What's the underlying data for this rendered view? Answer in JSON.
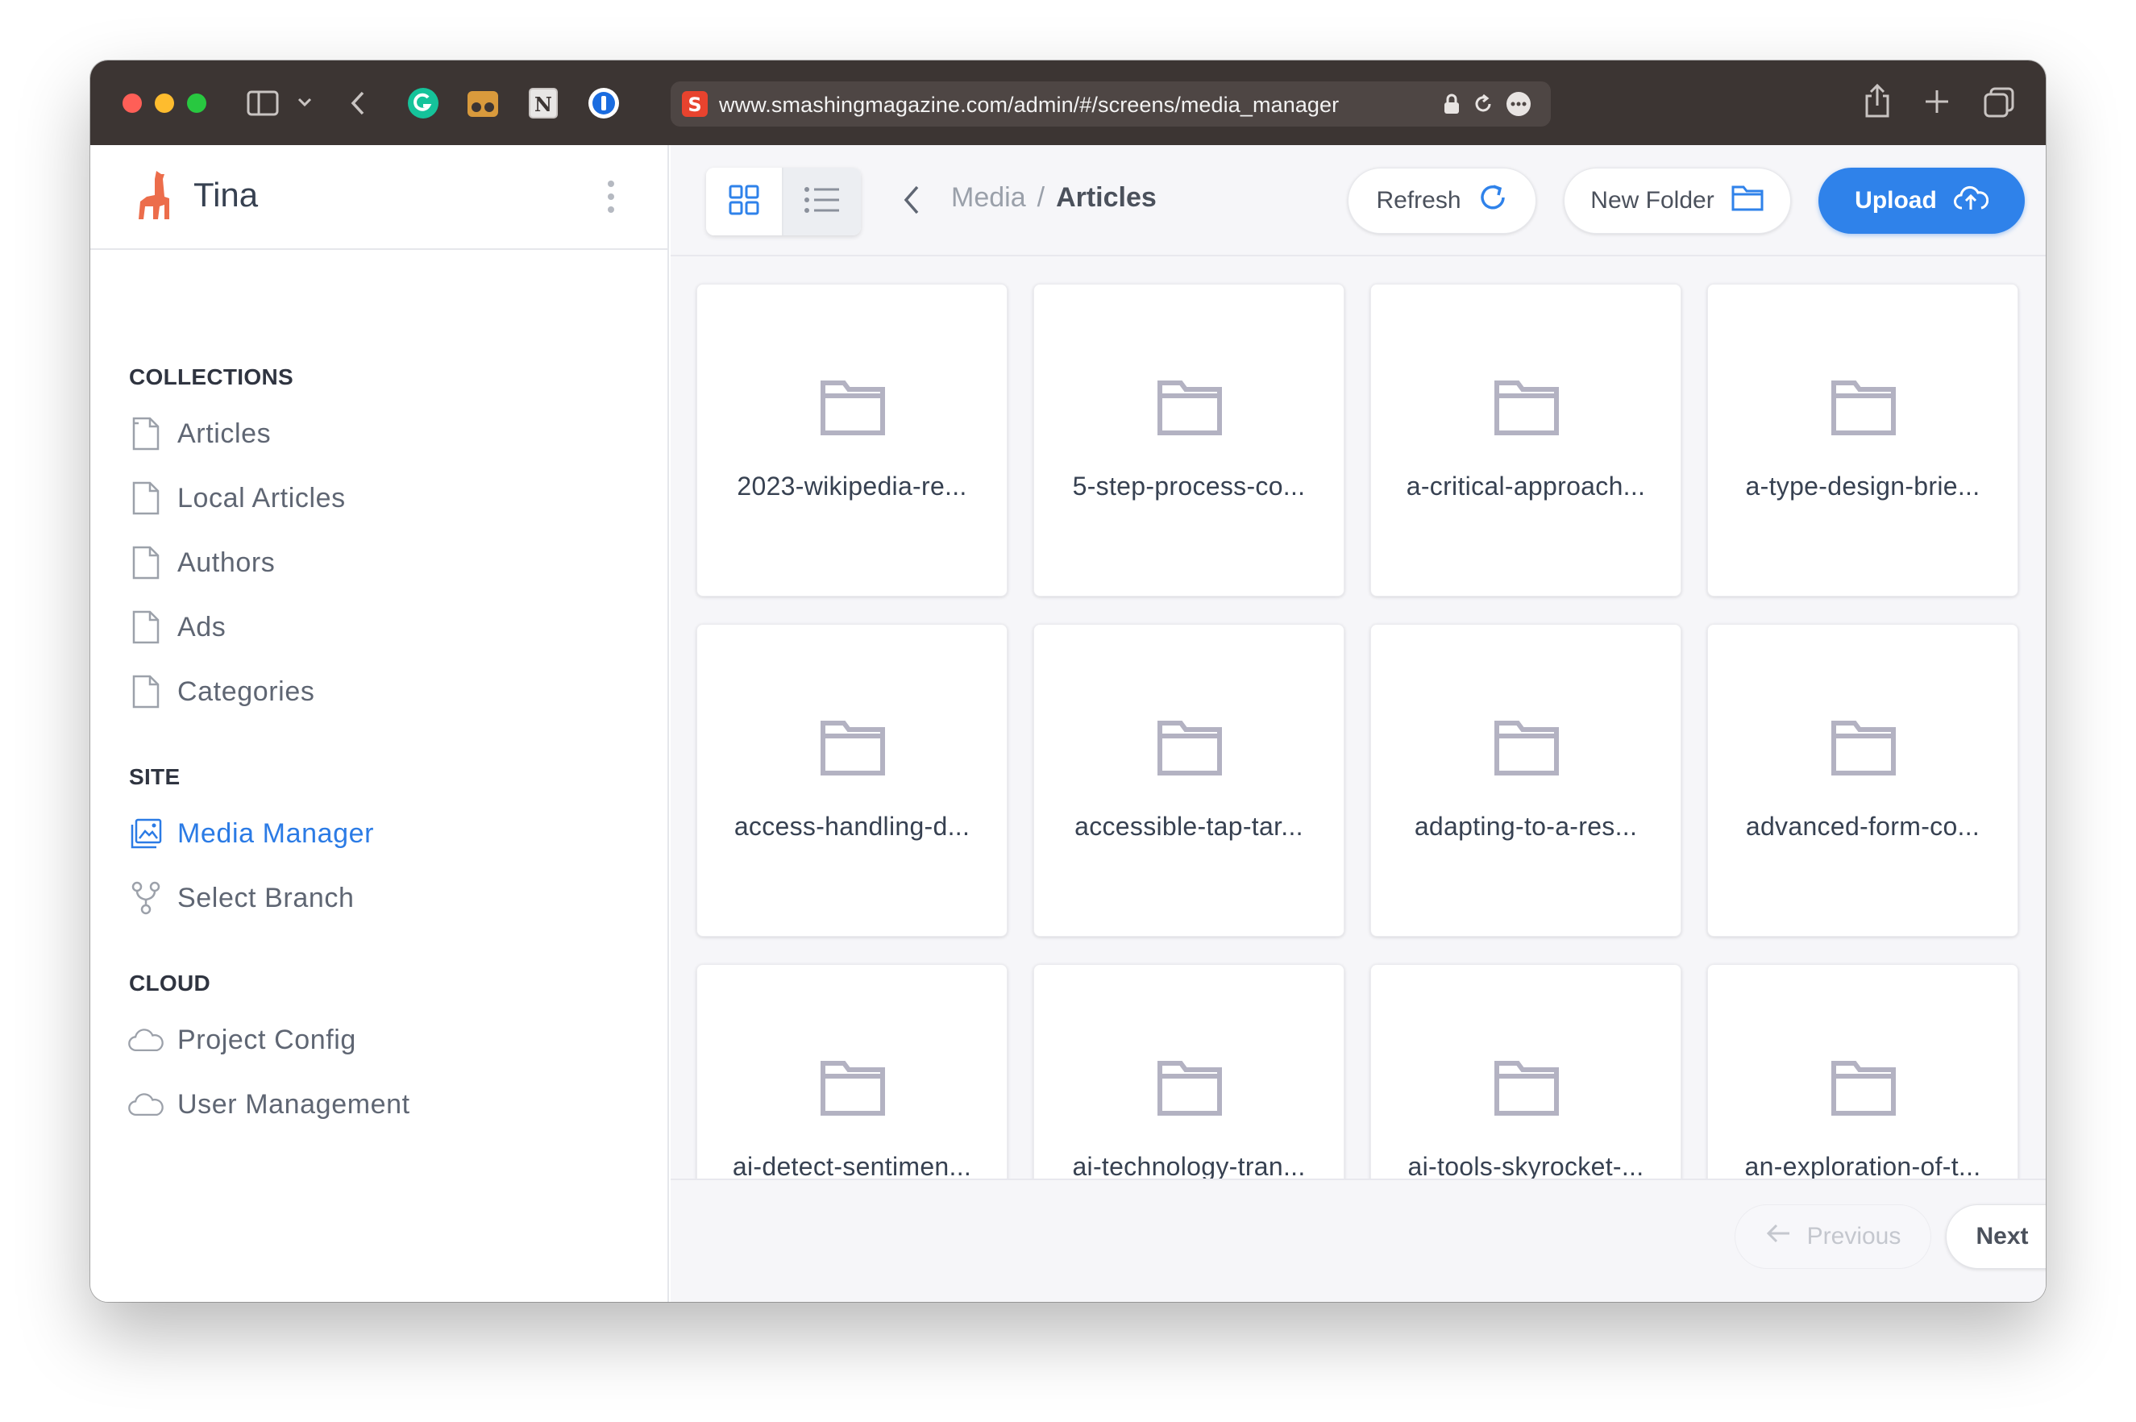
{
  "browser": {
    "url": "www.smashingmagazine.com/admin/#/screens/media_manager",
    "toolbar_icons": [
      "sidebar-toggle-icon",
      "chevron-down-icon",
      "back-arrow-icon",
      "grammarly-extension-icon",
      "glasses-extension-icon",
      "notion-extension-icon",
      "onepassword-extension-icon",
      "share-icon",
      "new-tab-icon",
      "tab-overview-icon"
    ]
  },
  "sidebar": {
    "brand": "Tina",
    "sections": {
      "collections": {
        "title": "COLLECTIONS",
        "items": [
          "Articles",
          "Local Articles",
          "Authors",
          "Ads",
          "Categories"
        ]
      },
      "site": {
        "title": "SITE",
        "items": [
          "Media Manager",
          "Select Branch"
        ]
      },
      "cloud": {
        "title": "CLOUD",
        "items": [
          "Project Config",
          "User Management"
        ]
      }
    },
    "active_item": "Media Manager"
  },
  "main": {
    "breadcrumb": {
      "root": "Media",
      "separator": "/",
      "current": "Articles"
    },
    "buttons": {
      "refresh": "Refresh",
      "new_folder": "New Folder",
      "upload": "Upload"
    },
    "folders": [
      "2023-wikipedia-re...",
      "5-step-process-co...",
      "a-critical-approach...",
      "a-type-design-brie...",
      "access-handling-d...",
      "accessible-tap-tar...",
      "adapting-to-a-res...",
      "advanced-form-co...",
      "ai-detect-sentimen...",
      "ai-technology-tran...",
      "ai-tools-skyrocket-...",
      "an-exploration-of-t..."
    ],
    "pagination": {
      "previous": "Previous",
      "next": "Next",
      "previous_enabled": false
    }
  },
  "colors": {
    "accent": "#2f82ea",
    "active_nav": "#2b7be5",
    "toolbar_bg": "#3c3533",
    "main_bg": "#f6f6f9",
    "folder_icon": "#b3b2c2",
    "brand_logo": "#ec6d4b"
  }
}
